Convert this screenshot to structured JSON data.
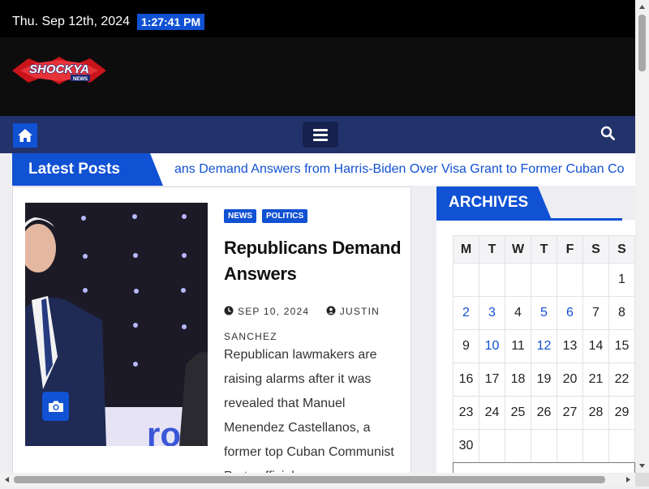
{
  "topbar": {
    "date": "Thu. Sep 12th, 2024",
    "time": "1:27:41 PM"
  },
  "header": {
    "logo_text": "SHOCKYA",
    "logo_sub": "NEWS"
  },
  "nav": {
    "home_icon": "home-icon",
    "menu_icon": "hamburger-icon",
    "search_icon": "search-icon"
  },
  "latest": {
    "label": "Latest Posts",
    "ticker": "ans Demand Answers from Harris-Biden Over Visa Grant to Former Cuban Co"
  },
  "post": {
    "badges": [
      "NEWS",
      "POLITICS"
    ],
    "title": "Republicans Demand Answers",
    "date": "SEP 10, 2024",
    "author": "JUSTIN SANCHEZ",
    "excerpt": "Republican lawmakers are raising alarms after it was revealed that Manuel Menendez Castellanos, a former top Cuban Communist Party official",
    "camera_icon": "camera-icon"
  },
  "archives": {
    "title": "ARCHIVES",
    "weekdays": [
      "M",
      "T",
      "W",
      "T",
      "F",
      "S",
      "S"
    ],
    "weeks": [
      [
        "",
        "",
        "",
        "",
        "",
        "",
        "1"
      ],
      [
        "2",
        "3",
        "4",
        "5",
        "6",
        "7",
        "8"
      ],
      [
        "9",
        "10",
        "11",
        "12",
        "13",
        "14",
        "15"
      ],
      [
        "16",
        "17",
        "18",
        "19",
        "20",
        "21",
        "22"
      ],
      [
        "23",
        "24",
        "25",
        "26",
        "27",
        "28",
        "29"
      ],
      [
        "30",
        "",
        "",
        "",
        "",
        "",
        ""
      ]
    ],
    "linked_days": [
      "2",
      "3",
      "5",
      "6",
      "10",
      "12"
    ]
  },
  "colors": {
    "accent": "#1151d3",
    "navbar": "#22326b",
    "topbar": "#000000"
  }
}
